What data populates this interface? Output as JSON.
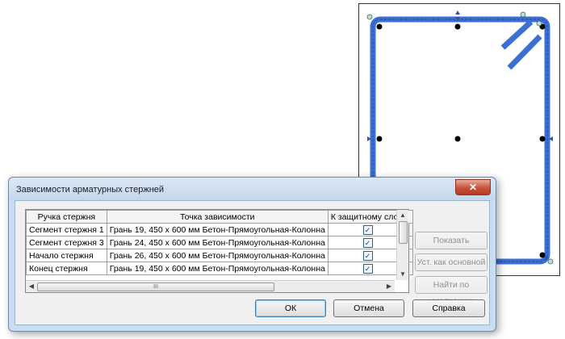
{
  "dialog": {
    "title": "Зависимости арматурных стержней",
    "close_glyph": "✕"
  },
  "table": {
    "headers": [
      "Ручка стержня",
      "Точка зависимости",
      "К защитному слою"
    ],
    "rows": [
      {
        "handle": "Сегмент стержня 1",
        "point": "Грань 19, 450 x 600 мм Бетон-Прямоугольная-Колонна",
        "to_cover": true
      },
      {
        "handle": "Сегмент стержня 3",
        "point": "Грань 24, 450 x 600 мм Бетон-Прямоугольная-Колонна",
        "to_cover": true
      },
      {
        "handle": "Начало стержня",
        "point": "Грань 26, 450 x 600 мм Бетон-Прямоугольная-Колонна",
        "to_cover": true
      },
      {
        "handle": "Конец стержня",
        "point": "Грань 19, 450 x 600 мм Бетон-Прямоугольная-Колонна",
        "to_cover": true
      }
    ],
    "scroll_grip": "III"
  },
  "side_buttons": {
    "show_current": "Показать текущую",
    "set_as_primary": "Уст. как основной",
    "find_default": "Найти по умолчанию"
  },
  "footer_buttons": {
    "ok": "ОК",
    "cancel": "Отмена",
    "help": "Справка"
  },
  "colors": {
    "rebar": "#3b6fd4",
    "dialog_frame": "#c9dcf0"
  }
}
